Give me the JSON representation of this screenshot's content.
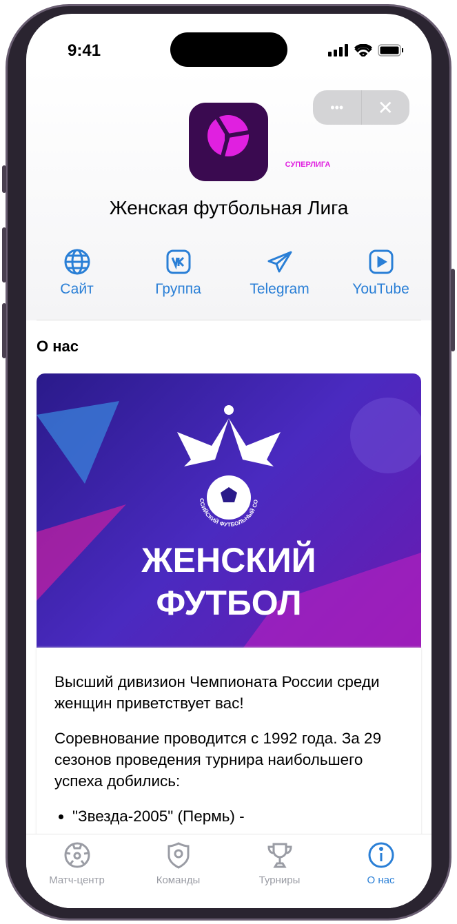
{
  "status": {
    "time": "9:41"
  },
  "capsule": {
    "more": "•••",
    "close": "✕"
  },
  "app": {
    "logo_text": "СУПЕРЛИГА",
    "title": "Женская футбольная Лига"
  },
  "links": [
    {
      "label": "Сайт",
      "icon": "globe-icon"
    },
    {
      "label": "Группа",
      "icon": "vk-icon"
    },
    {
      "label": "Telegram",
      "icon": "telegram-icon"
    },
    {
      "label": "YouTube",
      "icon": "youtube-icon"
    }
  ],
  "about": {
    "heading": "О нас",
    "banner_line1": "ЖЕНСКИЙ",
    "banner_line2": "ФУТБОЛ",
    "banner_emblem_text": "РОССИЙСКИЙ ФУТБОЛЬНЫЙ СОЮЗ",
    "p1": "Высший дивизион Чемпионата России среди женщин приветствует вас!",
    "p2": "Соревнование проводится с 1992 года. За 29 сезонов проведения турнира наибольшего успеха добились:",
    "list": [
      "\"Звезда-2005\" (Пермь) -"
    ]
  },
  "tabs": [
    {
      "label": "Матч-центр",
      "icon": "soccer-ball-icon"
    },
    {
      "label": "Команды",
      "icon": "shield-icon"
    },
    {
      "label": "Турниры",
      "icon": "trophy-icon"
    },
    {
      "label": "О нас",
      "icon": "info-icon",
      "active": true
    }
  ],
  "colors": {
    "accent": "#2a7fd6",
    "logo_bg": "#3a0a50",
    "logo_fg": "#e020e0"
  }
}
